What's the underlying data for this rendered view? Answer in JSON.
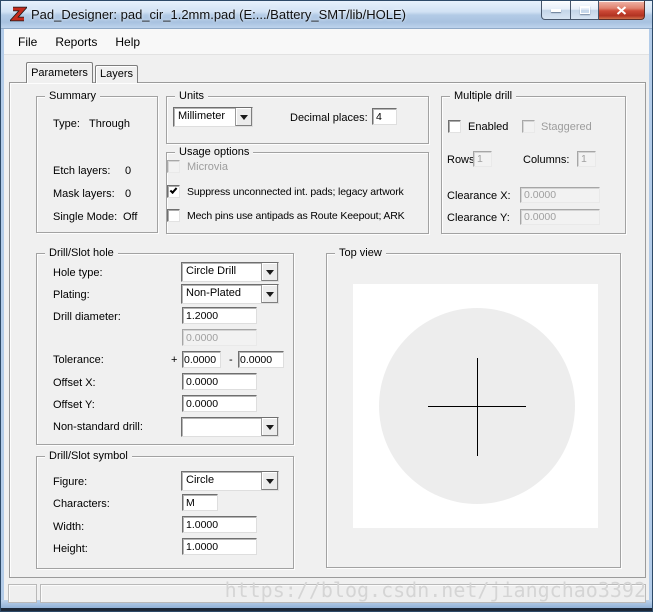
{
  "window": {
    "title": "Pad_Designer: pad_cir_1.2mm.pad (E:.../Battery_SMT/lib/HOLE)"
  },
  "menu": {
    "items": [
      "File",
      "Reports",
      "Help"
    ]
  },
  "tabs": {
    "parameters": "Parameters",
    "layers": "Layers"
  },
  "summary": {
    "title": "Summary",
    "type_label": "Type:",
    "type_value": "Through",
    "etch_label": "Etch layers:",
    "etch_value": "0",
    "mask_label": "Mask layers:",
    "mask_value": "0",
    "single_label": "Single Mode:",
    "single_value": "Off"
  },
  "units": {
    "title": "Units",
    "unit_value": "Millimeter",
    "decimal_label": "Decimal places:",
    "decimal_value": "4"
  },
  "usage": {
    "title": "Usage options",
    "microvia_label": "Microvia",
    "suppress_label": "Suppress unconnected int. pads; legacy artwork",
    "mech_label": "Mech pins use antipads as Route Keepout; ARK"
  },
  "multiple_drill": {
    "title": "Multiple drill",
    "enabled_label": "Enabled",
    "staggered_label": "Staggered",
    "rows_label": "Rows:",
    "rows_value": "1",
    "columns_label": "Columns:",
    "columns_value": "1",
    "clearance_x_label": "Clearance X:",
    "clearance_x_value": "0.0000",
    "clearance_y_label": "Clearance Y:",
    "clearance_y_value": "0.0000"
  },
  "drill_hole": {
    "title": "Drill/Slot hole",
    "hole_type_label": "Hole type:",
    "hole_type_value": "Circle Drill",
    "plating_label": "Plating:",
    "plating_value": "Non-Plated",
    "diameter_label": "Drill diameter:",
    "diameter_value": "1.2000",
    "diameter_secondary_value": "0.0000",
    "tolerance_label": "Tolerance:",
    "tolerance_plus_sign": "+",
    "tolerance_plus_value": "0.0000",
    "tolerance_minus_sign": "-",
    "tolerance_minus_value": "0.0000",
    "offset_x_label": "Offset X:",
    "offset_x_value": "0.0000",
    "offset_y_label": "Offset Y:",
    "offset_y_value": "0.0000",
    "nonstandard_label": "Non-standard drill:",
    "nonstandard_value": ""
  },
  "drill_symbol": {
    "title": "Drill/Slot symbol",
    "figure_label": "Figure:",
    "figure_value": "Circle",
    "characters_label": "Characters:",
    "characters_value": "M",
    "width_label": "Width:",
    "width_value": "1.0000",
    "height_label": "Height:",
    "height_value": "1.0000"
  },
  "top_view": {
    "title": "Top view"
  },
  "status": {
    "watermark": "https://blog.csdn.net/jiangchao3392"
  },
  "colors": {
    "titlebar_glass": "#b3cbe6",
    "close_button_red": "#cc4936",
    "dialog_gray": "#f0f0f0",
    "pad_fill": "#ededed",
    "watermark_gray": "#d5d5d5",
    "app_icon_red": "#c42b1c"
  }
}
